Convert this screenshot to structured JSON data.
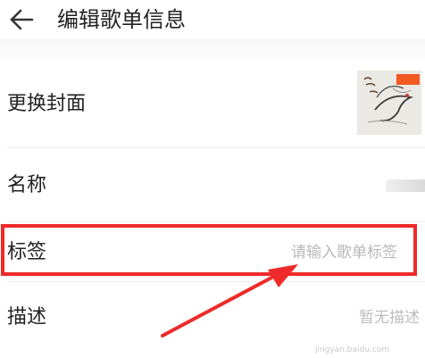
{
  "header": {
    "title": "编辑歌单信息",
    "back_icon": "back-arrow-icon"
  },
  "rows": {
    "cover": {
      "label": "更换封面"
    },
    "name": {
      "label": "名称"
    },
    "tags": {
      "label": "标签",
      "placeholder": "请输入歌单标签"
    },
    "description": {
      "label": "描述",
      "value": "暂无描述"
    }
  },
  "annotation": {
    "color": "#ee2a2a",
    "watermark": "jingyan.baidu.com"
  }
}
